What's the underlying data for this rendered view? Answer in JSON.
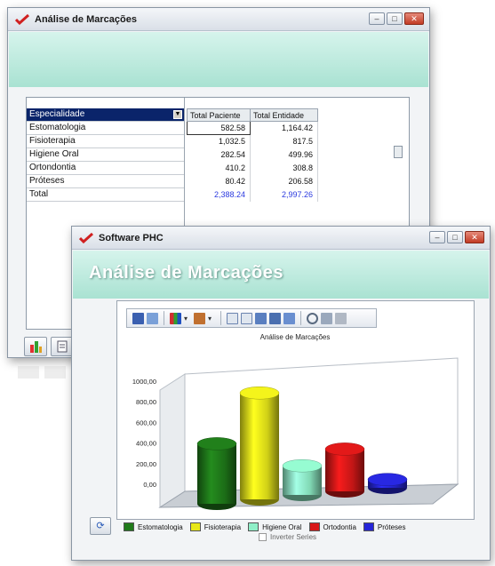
{
  "back_window": {
    "title": "Análise de Marcações",
    "grid": {
      "specialty_header": "Especialidade",
      "specialties": [
        "Estomatologia",
        "Fisioterapia",
        "Higiene Oral",
        "Ortondontia",
        "Próteses",
        "Total"
      ],
      "columns": [
        "Total Paciente",
        "Total Entidade"
      ],
      "rows": [
        [
          "582.58",
          "1,164.42"
        ],
        [
          "1,032.5",
          "817.5"
        ],
        [
          "282.54",
          "499.96"
        ],
        [
          "410.2",
          "308.8"
        ],
        [
          "80.42",
          "206.58"
        ],
        [
          "2,388.24",
          "2,997.26"
        ]
      ]
    }
  },
  "front_window": {
    "title": "Software PHC",
    "banner_title": "Análise de Marcações",
    "inverter_label": "Inverter Series"
  },
  "colors": {
    "estomatologia": "#1f7a1a",
    "fisioterapia": "#e8e81a",
    "higiene_oral": "#8ff0c8",
    "ortodontia": "#d81818",
    "proteses": "#2626d8"
  },
  "chart_data": {
    "type": "bar",
    "title": "Análise de Marcações",
    "categories": [
      "Estomatologia",
      "Fisioterapia",
      "Higiene Oral",
      "Ortodontia",
      "Próteses"
    ],
    "values": [
      582.58,
      1032.5,
      282.54,
      410.2,
      80.42
    ],
    "yticks": [
      "1000,00",
      "800,00",
      "600,00",
      "400,00",
      "200,00",
      "0,00"
    ],
    "ylim": [
      0,
      1000
    ],
    "legend_position": "bottom",
    "style": "3d-cylinder"
  }
}
